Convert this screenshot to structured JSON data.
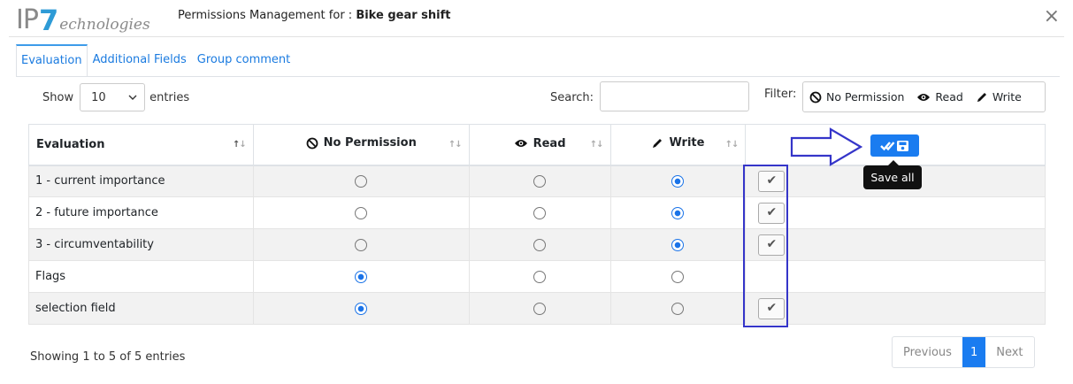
{
  "header": {
    "logo_ip": "IP",
    "logo_seven": "7",
    "logo_tech": "echnologies",
    "title_prefix": "Permissions Management for : ",
    "title_item": "Bike gear shift",
    "close_symbol": "×"
  },
  "tabs": [
    {
      "label": "Evaluation",
      "active": true
    },
    {
      "label": "Additional Fields",
      "active": false
    },
    {
      "label": "Group comment",
      "active": false
    }
  ],
  "controls": {
    "show_label": "Show",
    "entries_value": "10",
    "entries_label": "entries",
    "search_label": "Search:",
    "search_value": "",
    "filter_label": "Filter:",
    "filters": [
      {
        "label": "No Permission",
        "icon": "ban-icon"
      },
      {
        "label": "Read",
        "icon": "eye-icon"
      },
      {
        "label": "Write",
        "icon": "pencil-icon"
      }
    ]
  },
  "table": {
    "columns": [
      "Evaluation",
      "No Permission",
      "Read",
      "Write"
    ],
    "rows": [
      {
        "label": "1 - current importance",
        "selected": "write",
        "save_button": true
      },
      {
        "label": "2 - future importance",
        "selected": "write",
        "save_button": true
      },
      {
        "label": "3 - circumventability",
        "selected": "write",
        "save_button": true
      },
      {
        "label": "Flags",
        "selected": "none",
        "save_button": false
      },
      {
        "label": "selection field",
        "selected": "none",
        "save_button": true
      }
    ],
    "save_all_tooltip": "Save all",
    "save_row_symbol": "✔"
  },
  "footer": {
    "info": "Showing 1 to 5 of 5 entries",
    "previous": "Previous",
    "page": "1",
    "next": "Next"
  },
  "colors": {
    "accent": "#1a7cf0",
    "annotation": "#3535c9",
    "logo_blue": "#2e9bd6"
  }
}
